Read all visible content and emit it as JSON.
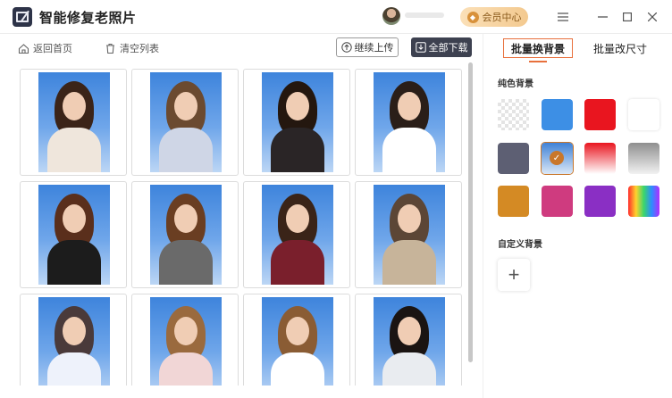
{
  "app": {
    "title": "智能修复老照片"
  },
  "header": {
    "vip_label": "会员中心"
  },
  "toolbar": {
    "back_home": "返回首页",
    "clear_list": "清空列表",
    "continue_upload": "继续上传",
    "download_all": "全部下载"
  },
  "photos": [
    {
      "id": "p1",
      "hair": "#3b2418",
      "top": "#efe6dc"
    },
    {
      "id": "p2",
      "hair": "#6b4a30",
      "top": "#cfd6e6"
    },
    {
      "id": "p3",
      "hair": "#24170f",
      "top": "#2a2526"
    },
    {
      "id": "p4",
      "hair": "#2a1e18",
      "top": "#ffffff"
    },
    {
      "id": "p5",
      "hair": "#5a2f1c",
      "top": "#1c1c1c"
    },
    {
      "id": "p6",
      "hair": "#6a3e22",
      "top": "#6a6a6a"
    },
    {
      "id": "p7",
      "hair": "#3a2418",
      "top": "#7a1f2c"
    },
    {
      "id": "p8",
      "hair": "#5c4636",
      "top": "#c7b49a"
    },
    {
      "id": "p9",
      "hair": "#4a3a3a",
      "top": "#eef2fb"
    },
    {
      "id": "p10",
      "hair": "#9a6a3e",
      "top": "#f1d6d6"
    },
    {
      "id": "p11",
      "hair": "#8a5c34",
      "top": "#ffffff"
    },
    {
      "id": "p12",
      "hair": "#1a1412",
      "top": "#e9ecf0"
    }
  ],
  "right_panel": {
    "tab_active": "批量换背景",
    "tab_other": "批量改尺寸",
    "solid_bg_label": "纯色背景",
    "custom_bg_label": "自定义背景",
    "add_label": "+",
    "selected_swatch": "gray-blue",
    "swatches": [
      {
        "name": "transparent",
        "color": "transparent"
      },
      {
        "name": "blue",
        "color": "#3d8fe5"
      },
      {
        "name": "red",
        "color": "#e9151f"
      },
      {
        "name": "white",
        "color": "#ffffff"
      },
      {
        "name": "slate",
        "color": "#5d5f73"
      },
      {
        "name": "gray-blue",
        "color": "#4b88d8"
      },
      {
        "name": "red-gradient",
        "color": "#e9151f"
      },
      {
        "name": "gray-gradient",
        "color": "#9a9a9a"
      },
      {
        "name": "orange",
        "color": "#d48a24"
      },
      {
        "name": "magenta",
        "color": "#cf3b7f"
      },
      {
        "name": "purple",
        "color": "#8a2fc4"
      },
      {
        "name": "rainbow",
        "color": "rainbow"
      }
    ]
  }
}
